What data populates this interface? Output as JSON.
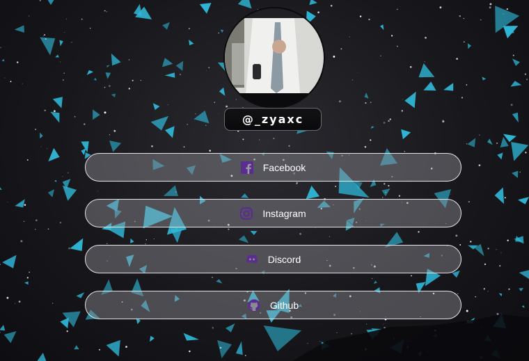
{
  "profile": {
    "handle": "@_zyaxc"
  },
  "links": [
    {
      "label": "Facebook",
      "icon": "facebook-icon"
    },
    {
      "label": "Instagram",
      "icon": "instagram-icon"
    },
    {
      "label": "Discord",
      "icon": "discord-icon"
    },
    {
      "label": "Github",
      "icon": "github-icon"
    }
  ],
  "colors": {
    "icon_accent": "#5b2d91",
    "shard": "#2fb8d8",
    "background": "#1c1c21"
  }
}
